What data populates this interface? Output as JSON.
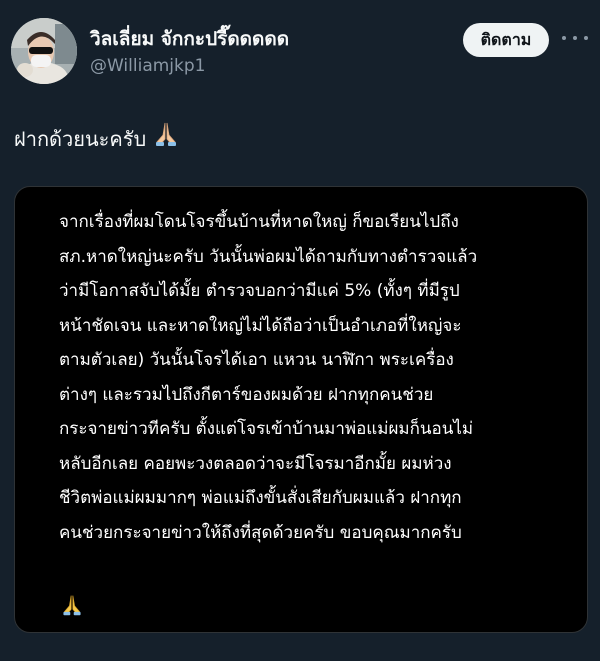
{
  "author": {
    "display_name": "วิลเลี่ยม จักกะปรี๊ดดดดด",
    "handle": "@Williamjkp1",
    "avatar_icon": "profile-photo"
  },
  "actions": {
    "follow_label": "ติดตาม",
    "more_icon": "more-horizontal-icon"
  },
  "tweet": {
    "text": "ฝากด้วยนะครับ",
    "emoji_icon": "folded-hands-emoji"
  },
  "image": {
    "lines": [
      "จากเรื่องที่ผมโดนโจรขึ้นบ้านที่หาดใหญ่ ก็ขอเรียนไปถึง",
      "สภ.หาดใหญ่นะครับ วันนั้นพ่อผมได้ถามกับทางตำรวจแล้ว",
      "ว่ามีโอกาสจับได้มั้ย ตำรวจบอกว่ามีแค่ 5% (ทั้งๆ ที่มีรูป",
      "หน้าชัดเจน และหาดใหญ่ไม่ได้ถือว่าเป็นอำเภอที่ใหญ่จะ",
      "ตามตัวเลย) วันนั้นโจรได้เอา แหวน นาฬิกา พระเครื่อง",
      "ต่างๆ และรวมไปถึงกีตาร์ของผมด้วย ฝากทุกคนช่วย",
      "กระจายข่าวทีครับ ตั้งแต่โจรเข้าบ้านมาพ่อแม่ผมก็นอนไม่",
      "หลับอีกเลย คอยพะวงตลอดว่าจะมีโจรมาอีกมั้ย ผมห่วง",
      "ชีวิตพ่อแม่ผมมากๆ พ่อแม่ถึงขั้นสั่งเสียกับผมแล้ว ฝากทุก",
      "คนช่วยกระจายข่าวให้ถึงที่สุดด้วยครับ ขอบคุณมากครับ"
    ],
    "emoji_icon": "folded-hands-emoji"
  },
  "colors": {
    "background": "#15202b",
    "text_primary": "#f7f9f9",
    "text_secondary": "#8b98a5",
    "button_bg": "#eff3f4",
    "button_text": "#0f1419",
    "image_bg": "#000000"
  }
}
